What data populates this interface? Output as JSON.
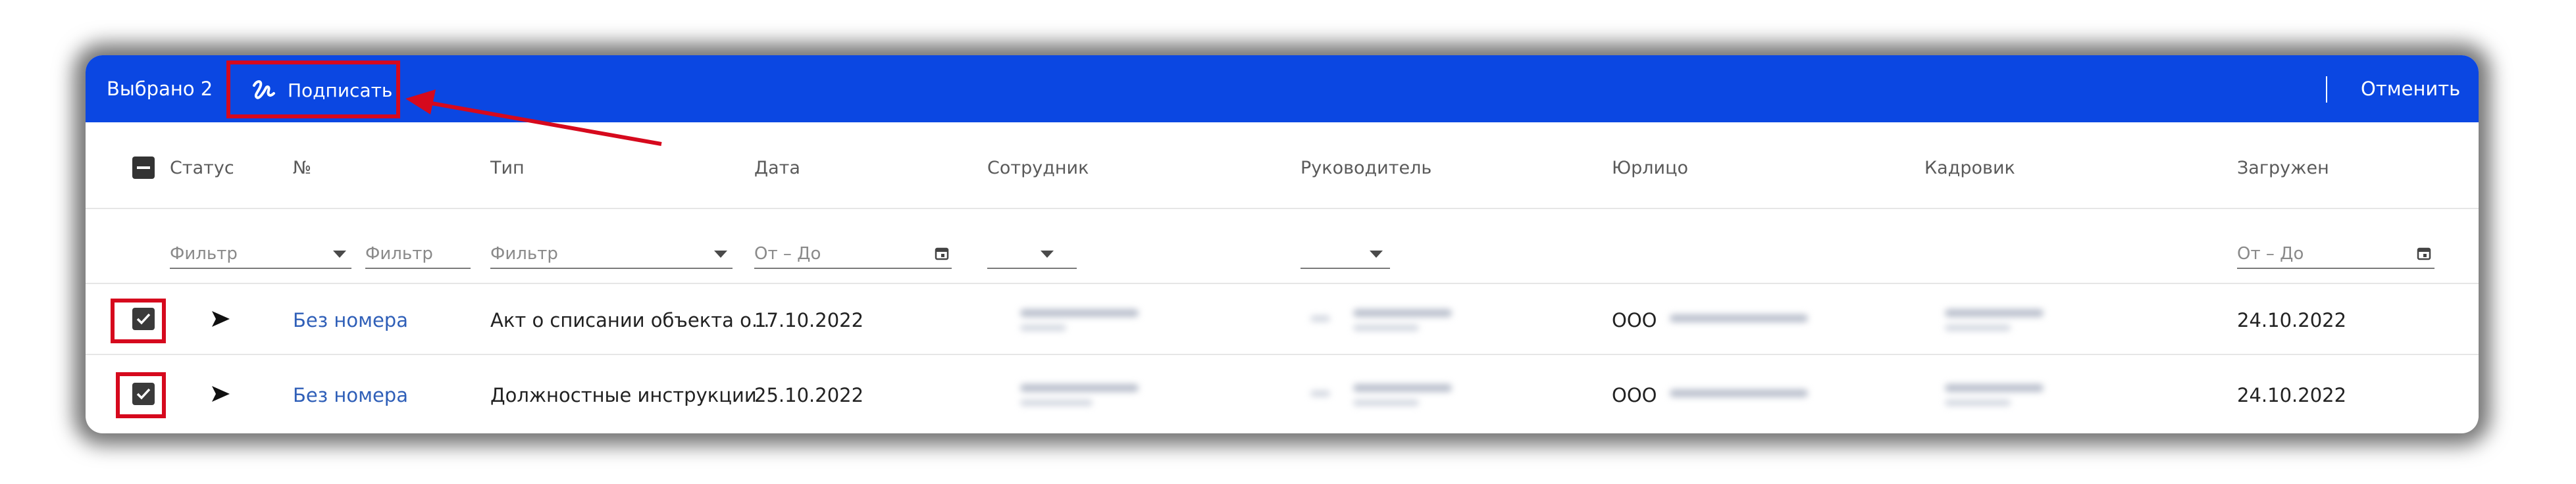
{
  "toolbar": {
    "selected_label": "Выбрано 2",
    "sign_label": "Подписать",
    "cancel_label": "Отменить",
    "bg_color": "#0b47e2",
    "highlight_color": "#d6091d"
  },
  "columns": [
    "Статус",
    "№",
    "Тип",
    "Дата",
    "Сотрудник",
    "Руководитель",
    "Юрлицо",
    "Кадровик",
    "Загружен"
  ],
  "filters": {
    "status_placeholder": "Фильтр",
    "number_placeholder": "Фильтр",
    "type_placeholder": "Фильтр",
    "date_placeholder": "От – До",
    "uploaded_placeholder": "От – До"
  },
  "rows": [
    {
      "number": "Без номера",
      "type": "Акт о списании объекта о...",
      "date": "17.10.2022",
      "legal_entity": "ООО",
      "uploaded": "24.10.2022",
      "checked": true
    },
    {
      "number": "Без номера",
      "type": "Должностные инструкции",
      "date": "25.10.2022",
      "legal_entity": "ООО",
      "uploaded": "24.10.2022",
      "checked": true
    }
  ],
  "icons": {
    "sign": "signature-icon",
    "status": "send-arrow-icon",
    "calendar": "calendar-icon"
  }
}
